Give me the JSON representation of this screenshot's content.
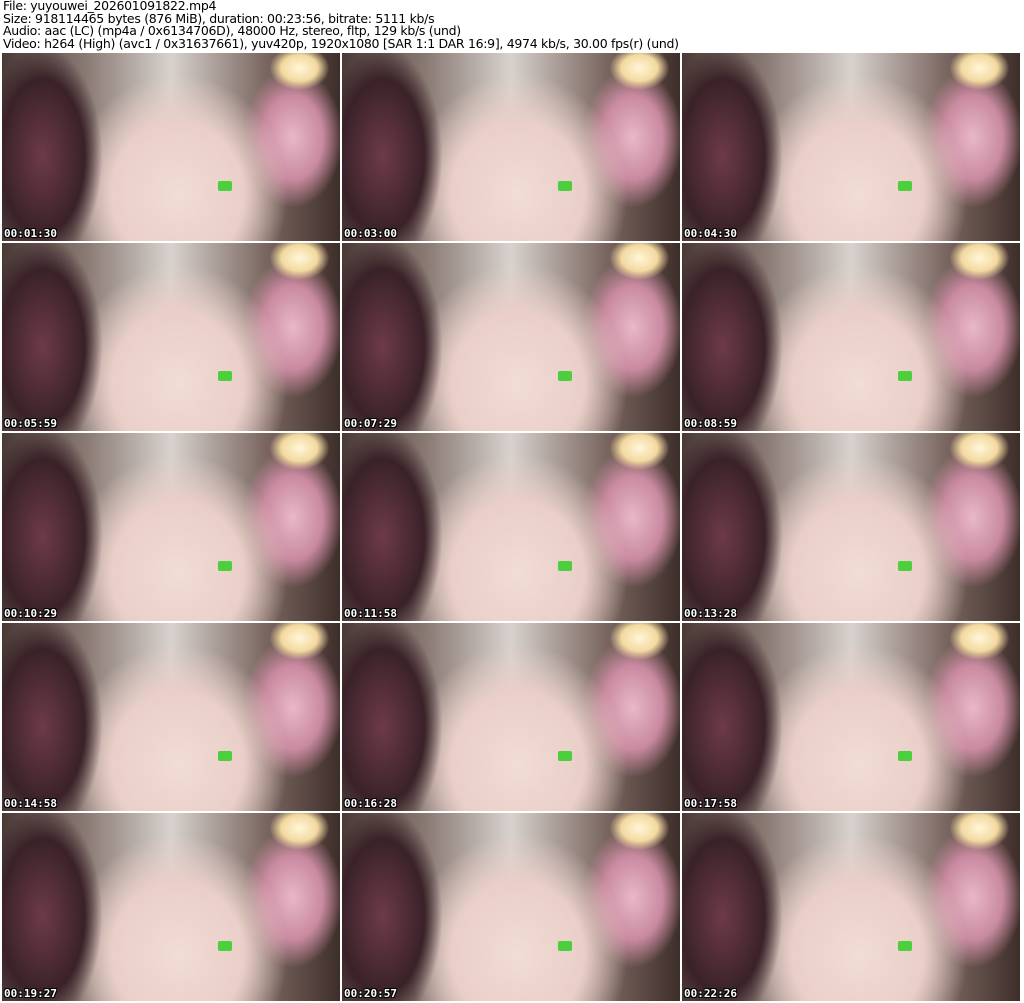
{
  "header": {
    "file": "File: yuyouwei_202601091822.mp4",
    "size": "Size: 918114465 bytes (876 MiB), duration: 00:23:56, bitrate: 5111 kb/s",
    "audio": "Audio: aac (LC) (mp4a / 0x6134706D), 48000 Hz, stereo, fltp, 129 kb/s (und)",
    "video": "Video: h264 (High) (avc1 / 0x31637661), yuv420p, 1920x1080 [SAR 1:1 DAR 16:9], 4974 kb/s, 30.00 fps(r) (und)"
  },
  "thumbnails": [
    {
      "timestamp": "00:01:30"
    },
    {
      "timestamp": "00:03:00"
    },
    {
      "timestamp": "00:04:30"
    },
    {
      "timestamp": "00:05:59"
    },
    {
      "timestamp": "00:07:29"
    },
    {
      "timestamp": "00:08:59"
    },
    {
      "timestamp": "00:10:29"
    },
    {
      "timestamp": "00:11:58"
    },
    {
      "timestamp": "00:13:28"
    },
    {
      "timestamp": "00:14:58"
    },
    {
      "timestamp": "00:16:28"
    },
    {
      "timestamp": "00:17:58"
    },
    {
      "timestamp": "00:19:27"
    },
    {
      "timestamp": "00:20:57"
    },
    {
      "timestamp": "00:22:26"
    }
  ]
}
